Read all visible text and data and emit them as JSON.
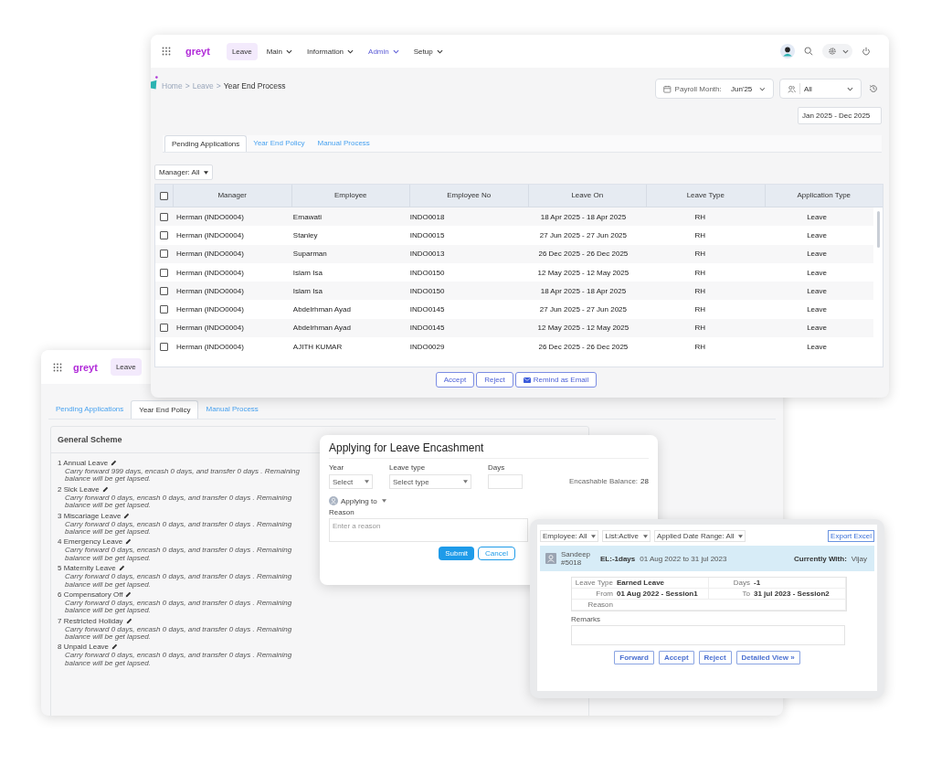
{
  "main_window": {
    "logo": "greyt",
    "nav": [
      {
        "label": "Leave",
        "selected": true,
        "highlighted": false,
        "dropdown": false
      },
      {
        "label": "Main",
        "selected": false,
        "highlighted": false,
        "dropdown": true
      },
      {
        "label": "Information",
        "selected": false,
        "highlighted": false,
        "dropdown": true
      },
      {
        "label": "Admin",
        "selected": false,
        "highlighted": true,
        "dropdown": true
      },
      {
        "label": "Setup",
        "selected": false,
        "highlighted": false,
        "dropdown": true
      }
    ],
    "breadcrumb": {
      "items": [
        "Home",
        "Leave"
      ],
      "separator": ">",
      "current": "Year End Process"
    },
    "payroll_month": {
      "label": "Payroll Month:",
      "value": "Jun'25"
    },
    "user_filter": "All",
    "date_range": "Jan 2025 - Dec 2025",
    "tabs": [
      {
        "label": "Pending Applications",
        "selected": true
      },
      {
        "label": "Year End Policy",
        "selected": false
      },
      {
        "label": "Manual Process",
        "selected": false
      }
    ],
    "manager_filter": "Manager: All",
    "table": {
      "all_checked": false,
      "columns": [
        "Manager",
        "Employee",
        "Employee No",
        "Leave On",
        "Leave Type",
        "Application Type"
      ],
      "rows": [
        {
          "checked": false,
          "cells": [
            "Herman (INDO0004)",
            "Ernawati",
            "INDO0018",
            "18 Apr 2025 - 18 Apr 2025",
            "RH",
            "Leave"
          ]
        },
        {
          "checked": false,
          "cells": [
            "Herman (INDO0004)",
            "Stanley",
            "INDO0015",
            "27 Jun 2025 - 27 Jun 2025",
            "RH",
            "Leave"
          ]
        },
        {
          "checked": false,
          "cells": [
            "Herman (INDO0004)",
            "Suparman",
            "INDO0013",
            "26 Dec 2025 - 26 Dec 2025",
            "RH",
            "Leave"
          ]
        },
        {
          "checked": false,
          "cells": [
            "Herman (INDO0004)",
            "Islam Isa",
            "INDO0150",
            "12 May 2025 - 12 May 2025",
            "RH",
            "Leave"
          ]
        },
        {
          "checked": false,
          "cells": [
            "Herman (INDO0004)",
            "Islam Isa",
            "INDO0150",
            "18 Apr 2025 - 18 Apr 2025",
            "RH",
            "Leave"
          ]
        },
        {
          "checked": false,
          "cells": [
            "Herman (INDO0004)",
            "Abdelrhman Ayad",
            "INDO0145",
            "27 Jun 2025 - 27 Jun 2025",
            "RH",
            "Leave"
          ]
        },
        {
          "checked": false,
          "cells": [
            "Herman (INDO0004)",
            "Abdelrhman Ayad",
            "INDO0145",
            "12 May 2025 - 12 May 2025",
            "RH",
            "Leave"
          ]
        },
        {
          "checked": false,
          "cells": [
            "Herman (INDO0004)",
            "AJITH KUMAR",
            "INDO0029",
            "26 Dec 2025 - 26 Dec 2025",
            "RH",
            "Leave"
          ]
        }
      ]
    },
    "buttons": [
      {
        "label": "Accept",
        "kind": "plain"
      },
      {
        "label": "Reject",
        "kind": "plain"
      },
      {
        "label": "Remind as Email",
        "kind": "email"
      }
    ]
  },
  "policy_window": {
    "logo": "greyt",
    "module": "Leave",
    "tabs": [
      {
        "label": "Pending Applications",
        "selected": false
      },
      {
        "label": "Year End Policy",
        "selected": true
      },
      {
        "label": "Manual Process",
        "selected": false
      }
    ],
    "panel_title": "General Scheme",
    "policies": [
      {
        "name": "1 Annual Leave",
        "note": "Carry forward 999 days, encash 0 days, and transfer 0 days . Remaining balance will be get lapsed."
      },
      {
        "name": "2 Sick Leave",
        "note": "Carry forward 0 days, encash 0 days, and transfer 0 days . Remaining balance will be get lapsed."
      },
      {
        "name": "3 Miscariage Leave",
        "note": "Carry forward 0 days, encash 0 days, and transfer 0 days . Remaining balance will be get lapsed."
      },
      {
        "name": "4 Emergency Leave",
        "note": "Carry forward 0 days, encash 0 days, and transfer 0 days . Remaining balance will be get lapsed."
      },
      {
        "name": "5 Maternity Leave",
        "note": "Carry forward 0 days, encash 0 days, and transfer 0 days . Remaining balance will be get lapsed."
      },
      {
        "name": "6 Compensatory Off",
        "note": "Carry forward 0 days, encash 0 days, and transfer 0 days . Remaining balance will be get lapsed."
      },
      {
        "name": "7 Restricted Holiday",
        "note": "Carry forward 0 days, encash 0 days, and transfer 0 days . Remaining balance will be get lapsed."
      },
      {
        "name": "8 Unpaid Leave",
        "note": "Carry forward 0 days, encash 0 days, and transfer 0 days . Remaining balance will be get lapsed."
      }
    ]
  },
  "encashment_dialog": {
    "title": "Applying for Leave Encashment",
    "year": {
      "label": "Year",
      "placeholder": "Select"
    },
    "leave_type": {
      "label": "Leave type",
      "placeholder": "Select type"
    },
    "days": {
      "label": "Days"
    },
    "balance": {
      "label": "Encashable Balance:",
      "value": "28"
    },
    "applying_to": "Applying to",
    "reason": {
      "label": "Reason",
      "placeholder": "Enter a reason"
    },
    "buttons": [
      {
        "label": "Submit",
        "kind": "primary"
      },
      {
        "label": "Cancel",
        "kind": "outline"
      }
    ]
  },
  "approval_window": {
    "filters": [
      "Employee: All",
      "List:Active",
      "Applied Date Range: All"
    ],
    "export": "Export Excel",
    "request": {
      "name": "Sandeep",
      "id": "#5018",
      "leave": "EL:-1days",
      "period": "01 Aug 2022 to 31 jul 2023",
      "currently_with_label": "Currently With:",
      "currently_with": "Vijay"
    },
    "details": [
      {
        "label": "Leave Type",
        "value": "Earned Leave"
      },
      {
        "label": "Days",
        "value": "-1"
      },
      {
        "label": "From",
        "value": "01 Aug 2022 - Session1"
      },
      {
        "label": "To",
        "value": "31 jul 2023 - Session2"
      }
    ],
    "reason_label": "Reason",
    "remarks_label": "Remarks",
    "buttons": [
      "Forward",
      "Accept",
      "Reject",
      "Detailed View »"
    ]
  }
}
